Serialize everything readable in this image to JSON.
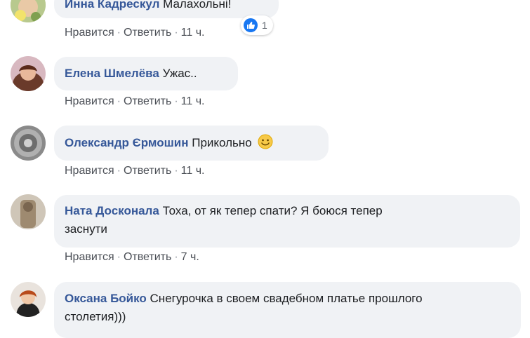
{
  "comments": [
    {
      "author": "Инна Кадрескул",
      "text": "Малахольні!",
      "actions": {
        "like": "Нравится",
        "reply": "Ответить",
        "time": "11 ч."
      },
      "reaction_count": "1"
    },
    {
      "author": "Елена Шмелёва",
      "text": "Ужас..",
      "actions": {
        "like": "Нравится",
        "reply": "Ответить",
        "time": "11 ч."
      }
    },
    {
      "author": "Олександр Єрмошин",
      "text": "Прикольно",
      "actions": {
        "like": "Нравится",
        "reply": "Ответить",
        "time": "11 ч."
      }
    },
    {
      "author": "Ната Досконала",
      "text": "Тоха, от як тепер спати? Я боюся тепер засн­ути",
      "text_line1": "Тоха, от як тепер спати? Я боюся тепер",
      "text_line2": "заснути",
      "actions": {
        "like": "Нравится",
        "reply": "Ответить",
        "time": "7 ч."
      }
    },
    {
      "author": "Оксана Бойко",
      "text_line1": "Снегурочка в своем свадебном платье прошлого",
      "text_line2": "столетия)))"
    }
  ],
  "colors": {
    "author": "#365899",
    "bubble": "#f0f2f5",
    "like_blue": "#1877f2"
  }
}
